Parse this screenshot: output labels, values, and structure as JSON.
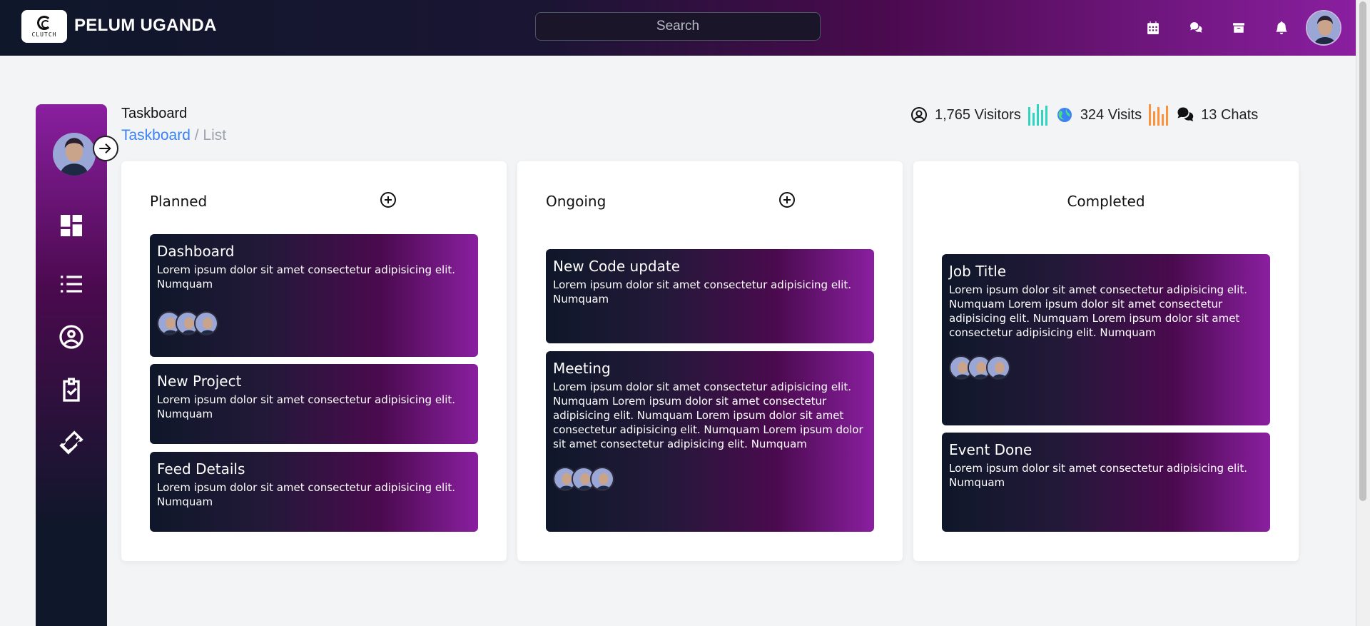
{
  "header": {
    "logo_text": "CLUTCH",
    "brand": "PELUM UGANDA",
    "search_placeholder": "Search",
    "icons": [
      "calendar-icon",
      "chat-icon",
      "archive-icon",
      "bell-icon"
    ]
  },
  "page": {
    "title": "Taskboard",
    "breadcrumb": {
      "link": "Taskboard",
      "separator": "/",
      "current": "List"
    }
  },
  "stats": {
    "visitors": "1,765 Visitors",
    "visits": "324 Visits",
    "chats": "13 Chats",
    "colors": {
      "visitors_bars": "#2dd4bf",
      "visits_bars": "#fb923c"
    }
  },
  "sidebar": {
    "items": [
      {
        "name": "dashboard",
        "icon": "dashboard-icon"
      },
      {
        "name": "list",
        "icon": "list-icon"
      },
      {
        "name": "profile",
        "icon": "user-circle-icon"
      },
      {
        "name": "tasks",
        "icon": "clipboard-check-icon"
      },
      {
        "name": "tickets",
        "icon": "ticket-icon"
      }
    ]
  },
  "columns": [
    {
      "title": "Planned",
      "cards": [
        {
          "title": "Dashboard",
          "body": "Lorem ipsum dolor sit amet consectetur adipisicing elit. Numquam"
        },
        {
          "title": "New Project",
          "body": "Lorem ipsum dolor sit amet consectetur adipisicing elit. Numquam"
        },
        {
          "title": "Feed Details",
          "body": "Lorem ipsum dolor sit amet consectetur adipisicing elit. Numquam"
        }
      ]
    },
    {
      "title": "Ongoing",
      "cards": [
        {
          "title": "New Code update",
          "body": "Lorem ipsum dolor sit amet consectetur adipisicing elit. Numquam"
        },
        {
          "title": "Meeting",
          "body": "Lorem ipsum dolor sit amet consectetur adipisicing elit. Numquam Lorem ipsum dolor sit amet consectetur adipisicing elit. Numquam Lorem ipsum dolor sit amet consectetur adipisicing elit. Numquam Lorem ipsum dolor sit amet consectetur adipisicing elit. Numquam"
        }
      ]
    },
    {
      "title": "Completed",
      "cards": [
        {
          "title": "Job Title",
          "body": "Lorem ipsum dolor sit amet consectetur adipisicing elit. Numquam Lorem ipsum dolor sit amet consectetur adipisicing elit. Numquam Lorem ipsum dolor sit amet consectetur adipisicing elit. Numquam"
        },
        {
          "title": "Event Done",
          "body": "Lorem ipsum dolor sit amet consectetur adipisicing elit. Numquam"
        }
      ]
    }
  ],
  "theme": {
    "gradient_dark": "#0f172a",
    "gradient_mid": "#4a0a4e",
    "gradient_light": "#8a1fa0",
    "link": "#3b82f6"
  }
}
